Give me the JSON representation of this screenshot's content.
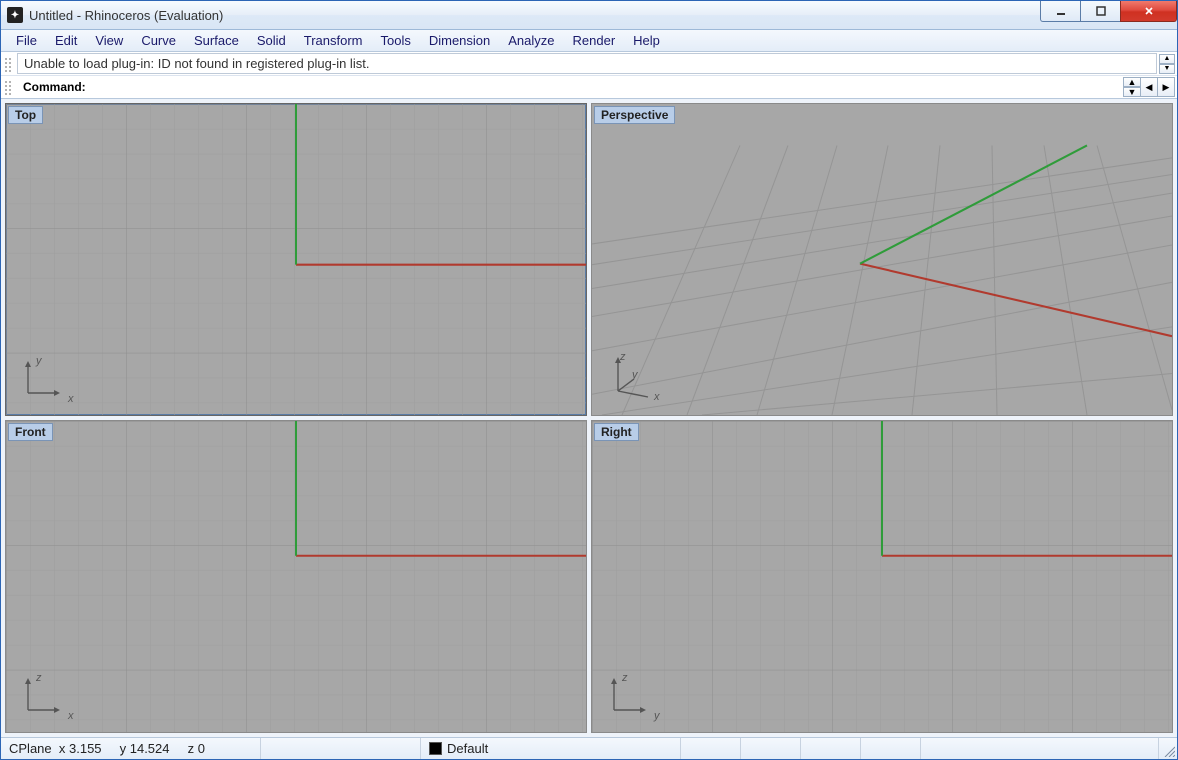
{
  "window": {
    "title": "Untitled - Rhinoceros (Evaluation)"
  },
  "menu": {
    "items": [
      "File",
      "Edit",
      "View",
      "Curve",
      "Surface",
      "Solid",
      "Transform",
      "Tools",
      "Dimension",
      "Analyze",
      "Render",
      "Help"
    ]
  },
  "command": {
    "history_line": "Unable to load plug-in: ID not found in registered plug-in list.",
    "prompt_label": "Command:"
  },
  "viewports": {
    "top_left": {
      "label": "Top",
      "axis_h": "x",
      "axis_v": "y"
    },
    "top_right": {
      "label": "Perspective",
      "axis_h": "x",
      "axis_v": "z",
      "axis_d": "y"
    },
    "bot_left": {
      "label": "Front",
      "axis_h": "x",
      "axis_v": "z"
    },
    "bot_right": {
      "label": "Right",
      "axis_h": "y",
      "axis_v": "z"
    }
  },
  "status": {
    "cplane_label": "CPlane",
    "x_label": "x",
    "x_value": "3.155",
    "y_label": "y",
    "y_value": "14.524",
    "z_label": "z",
    "z_value": "0",
    "layer_name": "Default"
  }
}
